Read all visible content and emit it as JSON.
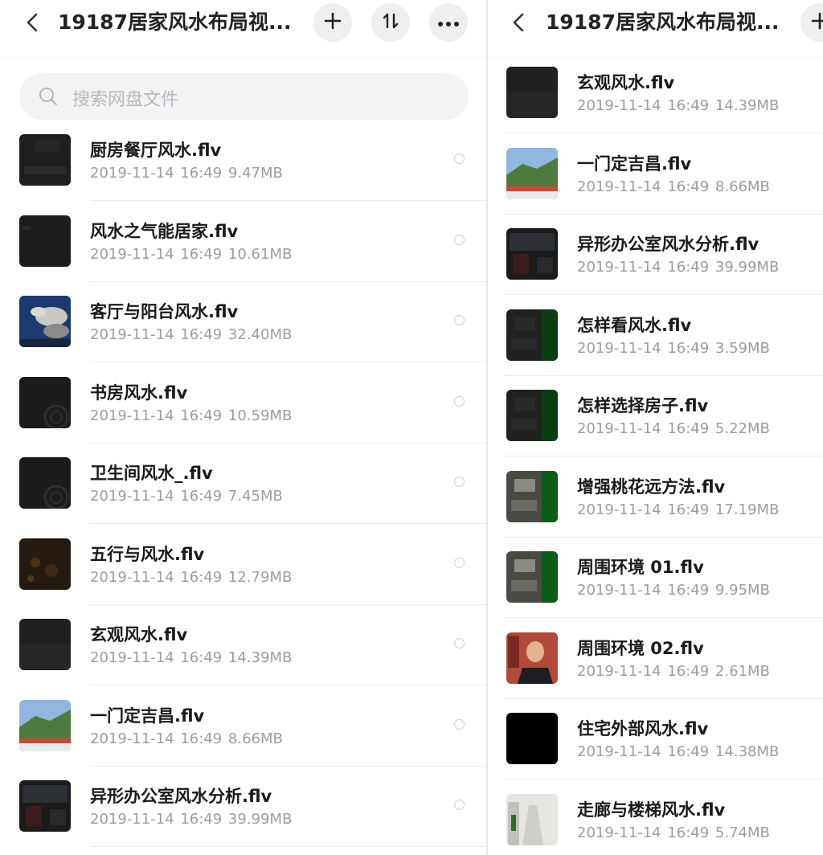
{
  "title": "19187居家风水布局视...",
  "search_placeholder": "搜索网盘文件",
  "icons": {
    "back": "chevron-left-icon",
    "add": "plus-icon",
    "sort": "sort-icon",
    "more": "more-horizontal-icon",
    "search": "search-icon"
  },
  "left_files": [
    {
      "name": "厨房餐厅风水.flv",
      "meta": "2019-11-14  16:49  9.47MB",
      "thumb": "dark-room"
    },
    {
      "name": "风水之气能居家.flv",
      "meta": "2019-11-14  16:49  10.61MB",
      "thumb": "dark"
    },
    {
      "name": "客厅与阳台风水.flv",
      "meta": "2019-11-14  16:49  32.40MB",
      "thumb": "sky"
    },
    {
      "name": "书房风水.flv",
      "meta": "2019-11-14  16:49  10.59MB",
      "thumb": "dark-circle"
    },
    {
      "name": "卫生间风水_.flv",
      "meta": "2019-11-14  16:49  7.45MB",
      "thumb": "dark-circle"
    },
    {
      "name": "五行与风水.flv",
      "meta": "2019-11-14  16:49  12.79MB",
      "thumb": "brown"
    },
    {
      "name": "玄观风水.flv",
      "meta": "2019-11-14  16:49  14.39MB",
      "thumb": "dark-gray"
    },
    {
      "name": "一门定吉昌.flv",
      "meta": "2019-11-14  16:49  8.66MB",
      "thumb": "mountain"
    },
    {
      "name": "异形办公室风水分析.flv",
      "meta": "2019-11-14  16:49  39.99MB",
      "thumb": "office"
    }
  ],
  "right_files": [
    {
      "name": "玄观风水.flv",
      "meta": "2019-11-14  16:49  14.39MB",
      "thumb": "dark-gray"
    },
    {
      "name": "一门定吉昌.flv",
      "meta": "2019-11-14  16:49  8.66MB",
      "thumb": "mountain"
    },
    {
      "name": "异形办公室风水分析.flv",
      "meta": "2019-11-14  16:49  39.99MB",
      "thumb": "office"
    },
    {
      "name": "怎样看风水.flv",
      "meta": "2019-11-14  16:49  3.59MB",
      "thumb": "green-room"
    },
    {
      "name": "怎样选择房子.flv",
      "meta": "2019-11-14  16:49  5.22MB",
      "thumb": "green-room"
    },
    {
      "name": "增强桃花远方法.flv",
      "meta": "2019-11-14  16:49  17.19MB",
      "thumb": "green-room-light"
    },
    {
      "name": "周围环境 01.flv",
      "meta": "2019-11-14  16:49  9.95MB",
      "thumb": "green-room-light"
    },
    {
      "name": "周围环境 02.flv",
      "meta": "2019-11-14  16:49  2.61MB",
      "thumb": "person"
    },
    {
      "name": "住宅外部风水.flv",
      "meta": "2019-11-14  16:49  14.38MB",
      "thumb": "black"
    },
    {
      "name": "走廊与楼梯风水.flv",
      "meta": "2019-11-14  16:49  5.74MB",
      "thumb": "hallway"
    }
  ]
}
